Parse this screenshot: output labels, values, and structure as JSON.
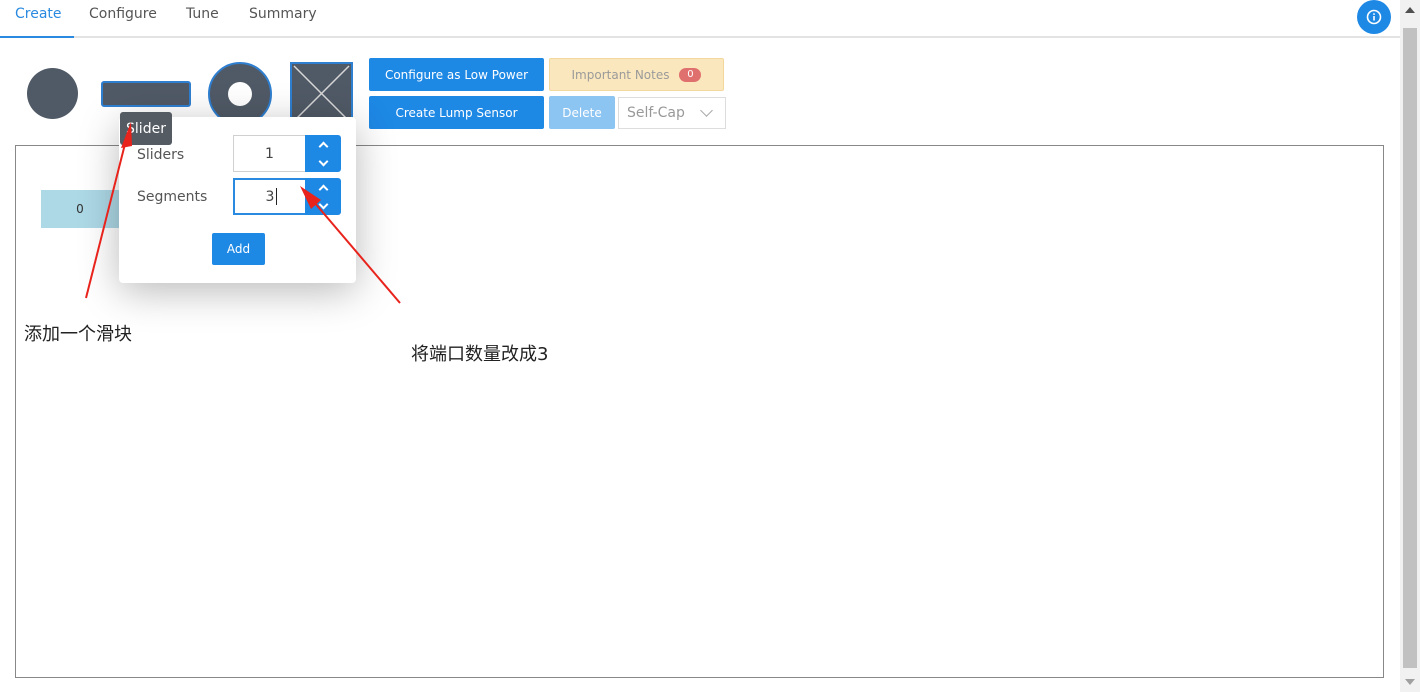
{
  "tabs": [
    {
      "label": "Create",
      "active": true
    },
    {
      "label": "Configure",
      "active": false
    },
    {
      "label": "Tune",
      "active": false
    },
    {
      "label": "Summary",
      "active": false
    }
  ],
  "info_icon": "info-circle-icon",
  "tools": [
    "button-sensor-icon",
    "slider-sensor-icon",
    "wheel-sensor-icon",
    "surface-sensor-icon"
  ],
  "toolbar": {
    "low_power_label": "Configure as Low Power",
    "lump_label": "Create Lump Sensor",
    "notes_label": "Important Notes",
    "notes_count": "0",
    "delete_label": "Delete",
    "mode_value": "Self-Cap"
  },
  "tooltip": "Slider",
  "popup": {
    "sliders_label": "Sliders",
    "sliders_value": "1",
    "segments_label": "Segments",
    "segments_value": "3",
    "add_label": "Add"
  },
  "canvas": {
    "segment_label": "0"
  },
  "annotations": {
    "add_slider": "添加一个滑块",
    "change_ports": "将端口数量改成3"
  },
  "colors": {
    "accent": "#1e88e5",
    "shape": "#505a66",
    "notes_bg": "#fbe7bd",
    "badge": "#e0706e",
    "arrow": "#e8231c"
  }
}
